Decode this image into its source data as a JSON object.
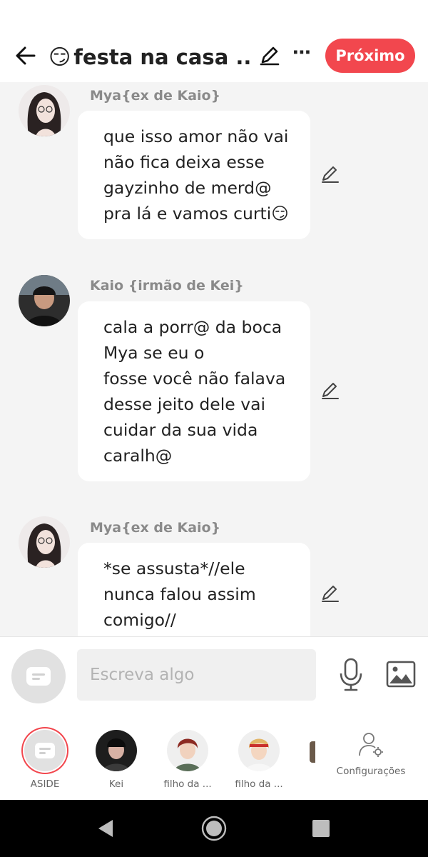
{
  "header": {
    "title_emoji": "😏",
    "title": "festa na casa ...",
    "next_label": "Próximo",
    "more_glyph": "⋯",
    "accent_color": "#f2474e"
  },
  "messages": [
    {
      "sender": "Mya{ex de Kaio}",
      "lines": [
        "que isso amor não vai",
        "não fica deixa esse",
        "gayzinho de merd@",
        "pra lá e vamos curti😏"
      ]
    },
    {
      "sender": "Kaio {irmão de Kei}",
      "lines": [
        "cala a porr@ da boca",
        "Mya se eu o",
        "fosse você não falava",
        "desse jeito dele vai",
        "cuidar da sua vida",
        "caralh@"
      ]
    },
    {
      "sender": "Mya{ex de Kaio}",
      "lines": [
        "*se assusta*//ele",
        "nunca falou assim",
        "comigo//"
      ]
    }
  ],
  "composer": {
    "placeholder": "Escreva algo",
    "icons": [
      "aside-icon",
      "microphone-icon",
      "image-icon"
    ]
  },
  "characters": [
    {
      "label": "ASIDE",
      "icon": "aside-icon",
      "selected": true
    },
    {
      "label": "Kei"
    },
    {
      "label": "filho da ..."
    },
    {
      "label": "filho da ..."
    }
  ],
  "settings_label": "Configurações"
}
